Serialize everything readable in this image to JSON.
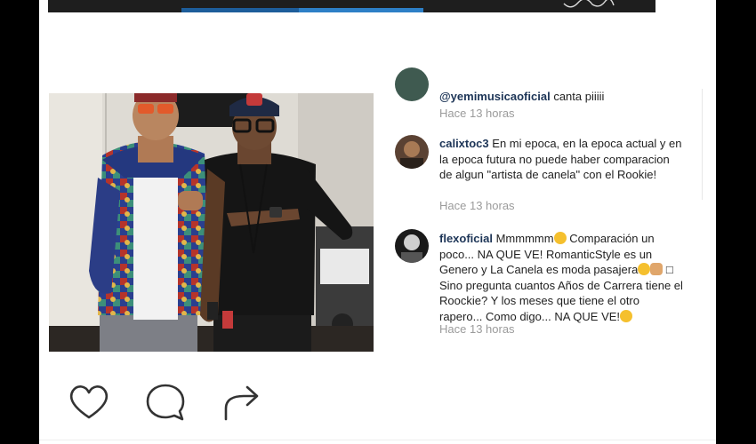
{
  "comments": [
    {
      "username": "@yemimusicaoficial",
      "text": "canta piiiii",
      "time": "Hace 13 horas"
    },
    {
      "username": "calixtoc3",
      "text": "En mi epoca, en la epoca actual y en la epoca futura no puede haber comparacion de algun \"artista de canela\" con el Rookie!",
      "time": "Hace 13 horas"
    },
    {
      "username": "flexoficial",
      "text_parts": [
        "Mmmmmm",
        " Comparación un poco... NA QUE VE! RomanticStyle es un Genero y La Canela es moda pasajera",
        " □ Sino pregunta cuantos Años de Carrera tiene el Roockie? Y los meses que tiene el otro rapero... Como digo... NA QUE VE!"
      ],
      "time": "Hace 13 horas"
    }
  ],
  "actions": {
    "like_icon": "heart-icon",
    "comment_icon": "comment-bubble-icon",
    "share_icon": "share-arrow-icon"
  },
  "colors": {
    "username": "#1d3557",
    "timestamp": "#9b9b9b",
    "frame": "#000000"
  }
}
